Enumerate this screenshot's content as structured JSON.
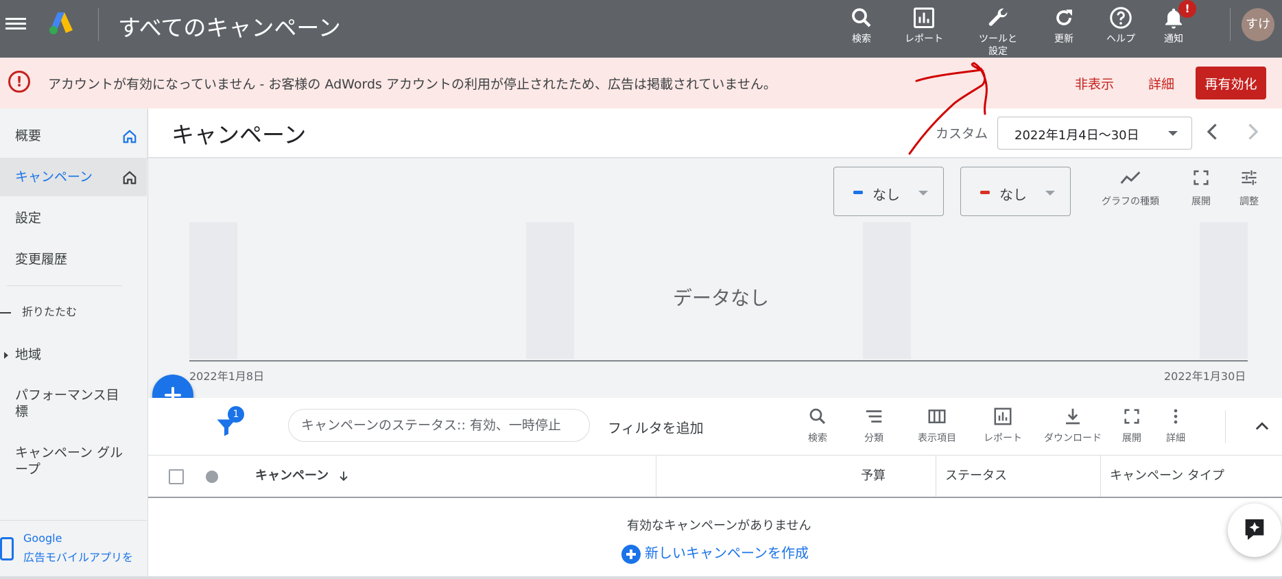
{
  "topbar": {
    "title": "すべてのキャンペーン",
    "items": [
      {
        "label": "検索",
        "icon": "search-icon"
      },
      {
        "label": "レポート",
        "icon": "report-icon"
      },
      {
        "label": "ツールと\n設定",
        "icon": "wrench-icon"
      },
      {
        "label": "更新",
        "icon": "refresh-icon"
      },
      {
        "label": "ヘルプ",
        "icon": "help-icon"
      },
      {
        "label": "通知",
        "icon": "bell-icon",
        "badge": "!"
      }
    ],
    "avatar": "すけ"
  },
  "alert": {
    "message": "アカウントが有効になっていません - お客様の AdWords アカウントの利用が停止されたため、広告は掲載されていません。",
    "hide_label": "非表示",
    "details_label": "詳細",
    "reactivate_label": "再有効化"
  },
  "sidebar": {
    "items": [
      {
        "label": "概要"
      },
      {
        "label": "キャンペーン",
        "active": true
      },
      {
        "label": "設定"
      },
      {
        "label": "変更履歴"
      }
    ],
    "collapse_label": "折りたたむ",
    "region_label": "地域",
    "performance_label": "パフォーマンス目標",
    "campaign_group_label": "キャンペーン グループ",
    "mobile_app_line1": "Google",
    "mobile_app_line2": "広告モバイルアプリを"
  },
  "header": {
    "title": "キャンペーン",
    "range_label": "カスタム",
    "date_range": "2022年1月4日～30日"
  },
  "chart": {
    "metric1": "なし",
    "metric2": "なし",
    "tools": [
      {
        "label": "グラフの種類",
        "icon": "chart-line-icon"
      },
      {
        "label": "展開",
        "icon": "expand-icon"
      },
      {
        "label": "調整",
        "icon": "tune-icon"
      }
    ],
    "no_data": "データなし",
    "x_start": "2022年1月8日",
    "x_end": "2022年1月30日"
  },
  "chart_data": {
    "type": "line",
    "x": [
      "2022年1月8日",
      "2022年1月30日"
    ],
    "series": [],
    "grid": true
  },
  "filter": {
    "badge": "1",
    "chip": "キャンペーンのステータス:: 有効、一時停止",
    "add_filter": "フィルタを追加",
    "tools": [
      {
        "label": "検索",
        "icon": "search-icon"
      },
      {
        "label": "分類",
        "icon": "segment-icon"
      },
      {
        "label": "表示項目",
        "icon": "columns-icon"
      },
      {
        "label": "レポート",
        "icon": "report-icon"
      },
      {
        "label": "ダウンロード",
        "icon": "download-icon"
      },
      {
        "label": "展開",
        "icon": "expand-icon"
      },
      {
        "label": "詳細",
        "icon": "more-vert-icon"
      }
    ]
  },
  "table": {
    "columns": [
      "キャンペーン",
      "予算",
      "ステータス",
      "キャンペーン タイプ"
    ],
    "empty_message": "有効なキャンペーンがありません",
    "create_label": "新しいキャンペーンを作成"
  },
  "colors": {
    "topbar": "#5f6368",
    "alert_bg": "#fce8e6",
    "alert_accent": "#c5221f",
    "primary": "#1a73e8",
    "metric1": "#1a73e8",
    "metric2": "#d93025"
  }
}
